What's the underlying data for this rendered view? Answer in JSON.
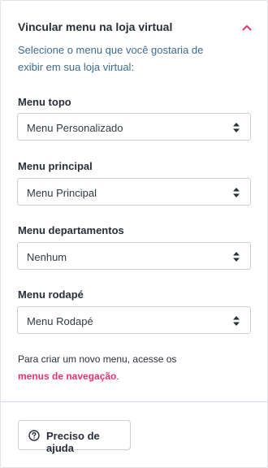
{
  "panel": {
    "title": "Vincular menu na loja virtual",
    "collapse_icon": "chevron-up-icon",
    "description": "Selecione o menu que você gostaria de exibir em sua loja virtual:"
  },
  "fields": [
    {
      "label": "Menu topo",
      "value": "Menu Personalizado"
    },
    {
      "label": "Menu principal",
      "value": "Menu Principal"
    },
    {
      "label": "Menu departamentos",
      "value": "Nenhum"
    },
    {
      "label": "Menu rodapé",
      "value": "Menu Rodapé"
    }
  ],
  "info": {
    "text": "Para criar um novo menu, acesse os",
    "link_text": "menus de navegação",
    "suffix": "."
  },
  "help_button": {
    "label": "Preciso de ajuda",
    "icon": "question-circle-icon"
  },
  "colors": {
    "accent": "#e8336f",
    "description_text": "#3d6b8f",
    "border": "#c9ced6"
  }
}
